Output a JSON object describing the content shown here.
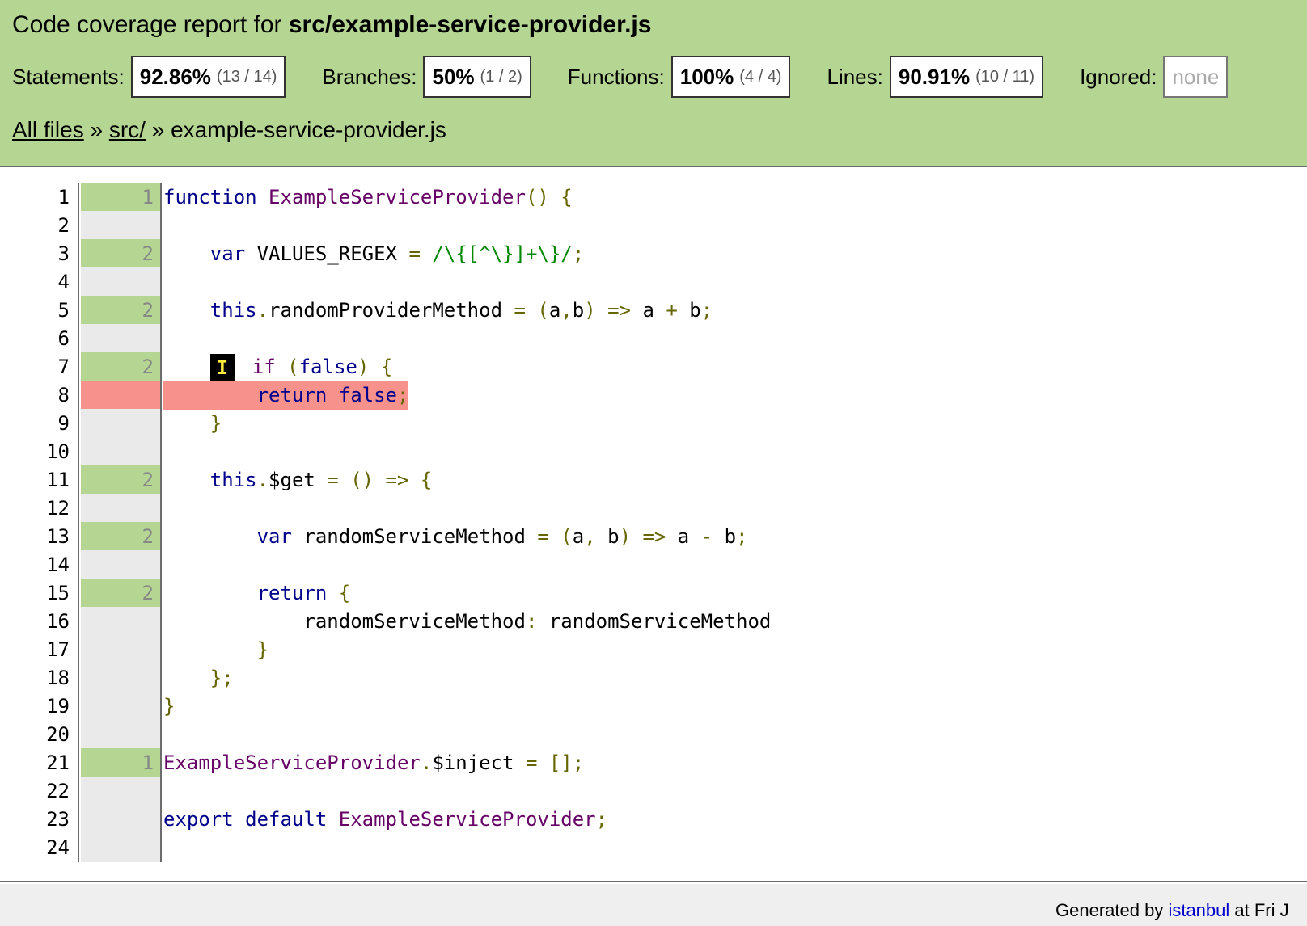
{
  "header": {
    "title_prefix": "Code coverage report for ",
    "title_file": "src/example-service-provider.js",
    "stats": [
      {
        "label": "Statements:",
        "pct": "92.86%",
        "frac": "(13 / 14)"
      },
      {
        "label": "Branches:",
        "pct": "50%",
        "frac": "(1 / 2)"
      },
      {
        "label": "Functions:",
        "pct": "100%",
        "frac": "(4 / 4)"
      },
      {
        "label": "Lines:",
        "pct": "90.91%",
        "frac": "(10 / 11)"
      }
    ],
    "ignored": {
      "label": "Ignored:",
      "value": "none"
    },
    "breadcrumb": {
      "all_files": "All files",
      "sep1": " » ",
      "dir": "src/",
      "sep2": " » ",
      "file": "example-service-provider.js"
    }
  },
  "code": {
    "lines": [
      {
        "n": "1",
        "hits": "1",
        "status": "yes"
      },
      {
        "n": "2",
        "hits": "",
        "status": "neutral"
      },
      {
        "n": "3",
        "hits": "2",
        "status": "yes"
      },
      {
        "n": "4",
        "hits": "",
        "status": "neutral"
      },
      {
        "n": "5",
        "hits": "2",
        "status": "yes"
      },
      {
        "n": "6",
        "hits": "",
        "status": "neutral"
      },
      {
        "n": "7",
        "hits": "2",
        "status": "yes"
      },
      {
        "n": "8",
        "hits": "",
        "status": "no"
      },
      {
        "n": "9",
        "hits": "",
        "status": "neutral"
      },
      {
        "n": "10",
        "hits": "",
        "status": "neutral"
      },
      {
        "n": "11",
        "hits": "2",
        "status": "yes"
      },
      {
        "n": "12",
        "hits": "",
        "status": "neutral"
      },
      {
        "n": "13",
        "hits": "2",
        "status": "yes"
      },
      {
        "n": "14",
        "hits": "",
        "status": "neutral"
      },
      {
        "n": "15",
        "hits": "2",
        "status": "yes"
      },
      {
        "n": "16",
        "hits": "",
        "status": "neutral"
      },
      {
        "n": "17",
        "hits": "",
        "status": "neutral"
      },
      {
        "n": "18",
        "hits": "",
        "status": "neutral"
      },
      {
        "n": "19",
        "hits": "",
        "status": "neutral"
      },
      {
        "n": "20",
        "hits": "",
        "status": "neutral"
      },
      {
        "n": "21",
        "hits": "1",
        "status": "yes"
      },
      {
        "n": "22",
        "hits": "",
        "status": "neutral"
      },
      {
        "n": "23",
        "hits": "",
        "status": "neutral"
      },
      {
        "n": "24",
        "hits": "",
        "status": "neutral"
      }
    ],
    "branch_badge": "I",
    "tokens": {
      "l1_kw": "function",
      "l1_fn": "ExampleServiceProvider",
      "l1_pn": "() {",
      "l3_kw": "var",
      "l3_id": " VALUES_REGEX ",
      "l3_pn": "=",
      "l3_re": "/\\{[^\\}]+\\}/",
      "l3_end": ";",
      "l5_kw": "this",
      "l5_pn1": ".",
      "l5_id": "randomProviderMethod ",
      "l5_pn2": "= (",
      "l5_a": "a",
      "l5_pn3": ",",
      "l5_b": "b",
      "l5_pn4": ") =>",
      "l5_expr": " a ",
      "l5_plus": "+",
      "l5_b2": " b",
      "l5_end": ";",
      "l7_kw": "if",
      "l7_pn1": " (",
      "l7_false": "false",
      "l7_pn2": ") {",
      "l8_kw": "return",
      "l8_false": "false",
      "l8_end": ";",
      "l9_pn": "}",
      "l11_kw": "this",
      "l11_pn1": ".",
      "l11_id": "$get ",
      "l11_pn2": "= () => {",
      "l13_kw": "var",
      "l13_id": " randomServiceMethod ",
      "l13_pn1": "= (",
      "l13_a": "a",
      "l13_pn2": ",",
      "l13_b": " b",
      "l13_pn3": ") =>",
      "l13_expr": " a ",
      "l13_minus": "-",
      "l13_b2": " b",
      "l13_end": ";",
      "l15_kw": "return",
      "l15_pn": " {",
      "l16_key": "randomServiceMethod",
      "l16_pn": ":",
      "l16_val": " randomServiceMethod",
      "l17_pn": "}",
      "l18_pn": "};",
      "l19_pn": "}",
      "l21_fn": "ExampleServiceProvider",
      "l21_pn1": ".",
      "l21_id": "$inject ",
      "l21_pn2": "= [];",
      "l23_kw": "export default",
      "l23_fn": "ExampleServiceProvider",
      "l23_end": ";"
    }
  },
  "footer": {
    "prefix": "Generated by ",
    "link": "istanbul",
    "suffix": " at Fri J"
  }
}
